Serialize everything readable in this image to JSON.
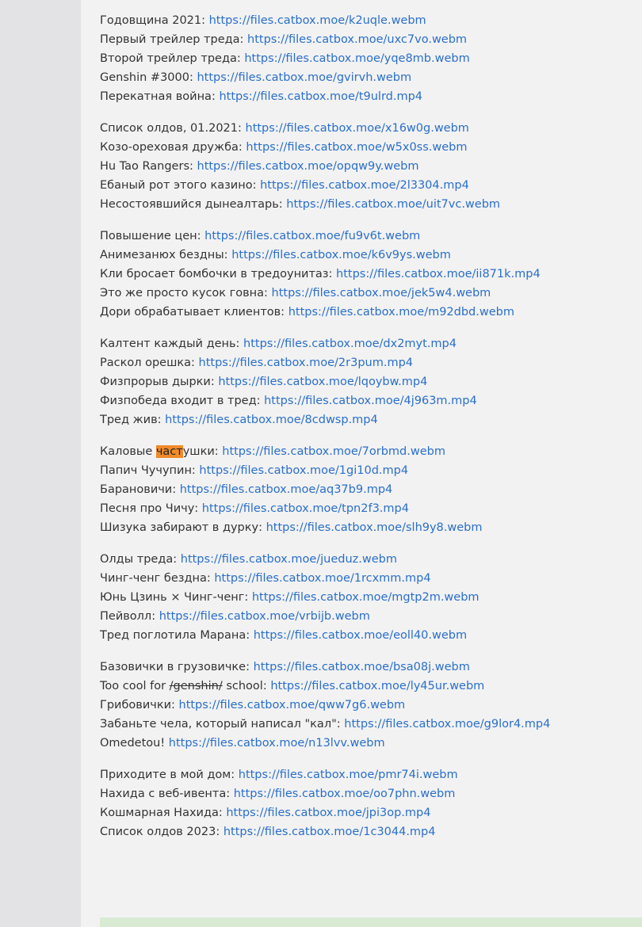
{
  "groups": [
    [
      {
        "pre": "Годовщина 2021: ",
        "url": "https://files.catbox.moe/k2uqle.webm"
      },
      {
        "pre": "Первый трейлер треда: ",
        "url": "https://files.catbox.moe/uxc7vo.webm"
      },
      {
        "pre": "Второй трейлер треда: ",
        "url": "https://files.catbox.moe/yqe8mb.webm"
      },
      {
        "pre": "Genshin #3000: ",
        "url": "https://files.catbox.moe/gvirvh.webm"
      },
      {
        "pre": "Перекатная война: ",
        "url": "https://files.catbox.moe/t9ulrd.mp4"
      }
    ],
    [
      {
        "pre": "Список олдов, 01.2021: ",
        "url": "https://files.catbox.moe/x16w0g.webm"
      },
      {
        "pre": "Козо-ореховая дружба: ",
        "url": "https://files.catbox.moe/w5x0ss.webm"
      },
      {
        "pre": "Hu Tao Rangers: ",
        "url": "https://files.catbox.moe/opqw9y.webm"
      },
      {
        "pre": "Ебаный рот этого казино: ",
        "url": "https://files.catbox.moe/2l3304.mp4"
      },
      {
        "pre": "Несостоявшийся дынеалтарь: ",
        "url": "https://files.catbox.moe/uit7vc.webm"
      }
    ],
    [
      {
        "pre": "Повышение цен: ",
        "url": "https://files.catbox.moe/fu9v6t.webm"
      },
      {
        "pre": "Анимезанюх бездны: ",
        "url": "https://files.catbox.moe/k6v9ys.webm"
      },
      {
        "pre": "Кли бросает бомбочки в тредоунитаз: ",
        "url": "https://files.catbox.moe/ii871k.mp4"
      },
      {
        "pre": "Это же просто кусок говна: ",
        "url": "https://files.catbox.moe/jek5w4.webm"
      },
      {
        "pre": "Дори обрабатывает клиентов: ",
        "url": "https://files.catbox.moe/m92dbd.webm"
      }
    ],
    [
      {
        "pre": "Калтент каждый день: ",
        "url": "https://files.catbox.moe/dx2myt.mp4"
      },
      {
        "pre": "Раскол орешка: ",
        "url": "https://files.catbox.moe/2r3pum.mp4"
      },
      {
        "pre": "Физпрорыв дырки: ",
        "url": "https://files.catbox.moe/lqoybw.mp4"
      },
      {
        "pre": "Физпобеда входит в тред: ",
        "url": "https://files.catbox.moe/4j963m.mp4"
      },
      {
        "pre": "Тред жив: ",
        "url": "https://files.catbox.moe/8cdwsp.mp4"
      }
    ],
    [
      {
        "pre": "Каловые ",
        "hl": "част",
        "post": "ушки: ",
        "url": "https://files.catbox.moe/7orbmd.webm"
      },
      {
        "pre": "Папич Чучупин: ",
        "url": "https://files.catbox.moe/1gi10d.mp4"
      },
      {
        "pre": "Барановичи: ",
        "url": "https://files.catbox.moe/aq37b9.mp4"
      },
      {
        "pre": "Песня про Чичу: ",
        "url": "https://files.catbox.moe/tpn2f3.mp4"
      },
      {
        "pre": "Шизука забирают в дурку: ",
        "url": "https://files.catbox.moe/slh9y8.webm"
      }
    ],
    [
      {
        "pre": "Олды треда: ",
        "url": "https://files.catbox.moe/jueduz.webm"
      },
      {
        "pre": "Чинг-ченг бездна: ",
        "url": "https://files.catbox.moe/1rcxmm.mp4"
      },
      {
        "pre": "Юнь Цзинь × Чинг-ченг: ",
        "url": "https://files.catbox.moe/mgtp2m.webm"
      },
      {
        "pre": "Пейволл: ",
        "url": "https://files.catbox.moe/vrbijb.webm"
      },
      {
        "pre": "Тред поглотила Марана: ",
        "url": "https://files.catbox.moe/eoll40.webm"
      }
    ],
    [
      {
        "pre": "Базовички в грузовичке: ",
        "url": "https://files.catbox.moe/bsa08j.webm"
      },
      {
        "pre": "Too cool for ",
        "strike": "/genshin/",
        "post": " school: ",
        "url": "https://files.catbox.moe/ly45ur.webm"
      },
      {
        "pre": "Грибовички: ",
        "url": "https://files.catbox.moe/qww7g6.webm"
      },
      {
        "pre": "Забаньте чела, который написал \"кал\": ",
        "url": "https://files.catbox.moe/g9lor4.mp4"
      },
      {
        "pre": "Omedetou! ",
        "url": "https://files.catbox.moe/n13lvv.webm"
      }
    ],
    [
      {
        "pre": "Приходите в мой дом: ",
        "url": "https://files.catbox.moe/pmr74i.webm"
      },
      {
        "pre": "Нахида с веб-ивента: ",
        "url": "https://files.catbox.moe/oo7phn.webm"
      },
      {
        "pre": "Кошмарная Нахида: ",
        "url": "https://files.catbox.moe/jpi3op.mp4"
      },
      {
        "pre": "Список олдов 2023: ",
        "url": "https://files.catbox.moe/1c3044.mp4"
      }
    ]
  ]
}
